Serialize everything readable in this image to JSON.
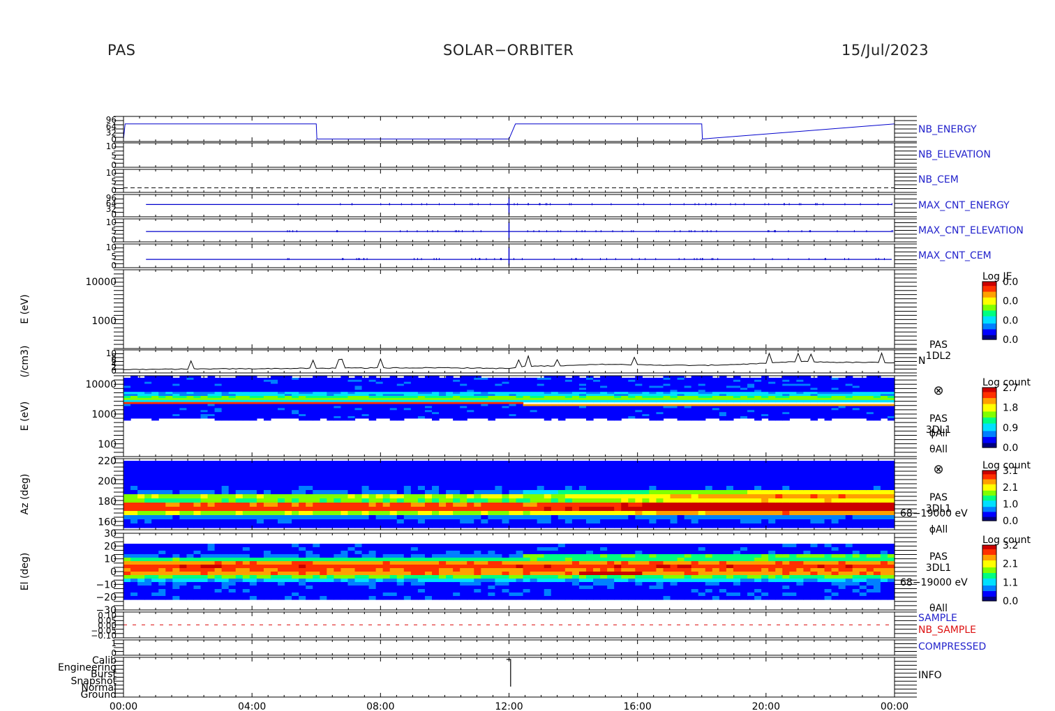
{
  "header": {
    "left": "PAS",
    "center": "SOLAR−ORBITER",
    "right": "15/Jul/2023"
  },
  "colors": {
    "trace_blue": "#0000cc",
    "label_blue": "#2222cc",
    "label_red": "#dd1111",
    "axis": "#000000",
    "spectro_cmap": [
      "#000080",
      "#0000ff",
      "#0080ff",
      "#00e0ff",
      "#00ff80",
      "#80ff00",
      "#ffff00",
      "#ffa000",
      "#ff3000",
      "#cc0000"
    ]
  },
  "x_axis": {
    "ticks": [
      "00:00",
      "04:00",
      "08:00",
      "12:00",
      "16:00",
      "20:00",
      "00:00"
    ]
  },
  "chart_data": [
    {
      "type": "line",
      "panel": "NB_ENERGY",
      "right_label": "NB_ENERGY",
      "label_color": "blue",
      "y_ticks": [
        "96",
        "64",
        "32",
        "0"
      ],
      "x_hours": [
        0,
        0.05,
        6,
        6.02,
        12,
        12.2,
        18,
        18.02,
        24
      ],
      "y_frac": [
        0.9,
        0.3,
        0.3,
        0.9,
        0.9,
        0.3,
        0.3,
        0.9,
        0.3
      ]
    },
    {
      "type": "line",
      "panel": "NB_ELEVATION",
      "right_label": "NB_ELEVATION",
      "label_color": "blue",
      "y_ticks": [
        "10",
        "5",
        "0"
      ]
    },
    {
      "type": "line",
      "panel": "NB_CEM",
      "right_label": "NB_CEM",
      "label_color": "blue",
      "y_ticks": [
        "10",
        "5",
        "0"
      ],
      "dashed_level_frac": 0.2
    },
    {
      "type": "line",
      "panel": "MAX_CNT_ENERGY",
      "right_label": "MAX_CNT_ENERGY",
      "label_color": "blue",
      "y_ticks": [
        "96",
        "64",
        "32",
        "0"
      ],
      "level_frac": 0.55,
      "spike_hour": 12.0
    },
    {
      "type": "line",
      "panel": "MAX_CNT_ELEVATION",
      "right_label": "MAX_CNT_ELEVATION",
      "label_color": "blue",
      "y_ticks": [
        "10",
        "5",
        "0"
      ],
      "level_frac": 0.45,
      "spike_hour": 12.0
    },
    {
      "type": "line",
      "panel": "MAX_CNT_CEM",
      "right_label": "MAX_CNT_CEM",
      "label_color": "blue",
      "y_ticks": [
        "10",
        "5",
        "0"
      ],
      "level_frac": 0.35,
      "spike_hour": 12.0
    },
    {
      "type": "heatmap",
      "panel": "PAS_1DL2_energy",
      "ylabel": "E (eV)",
      "y_ticks": [
        "10000",
        "1000"
      ],
      "colorbar": {
        "title": "Log JE",
        "ticks": [
          "0.0",
          "0.0",
          "0.0",
          "0.0"
        ]
      },
      "empty": true
    },
    {
      "type": "line",
      "panel": "PAS_1DL2_density",
      "ylabel": "(/cm3)",
      "right_label": "N",
      "annotation": [
        "PAS",
        "1DL2"
      ],
      "y_ticks": [
        "10",
        "8",
        "6",
        "4",
        "2",
        "0"
      ],
      "x_hours": [
        0,
        2,
        4,
        6,
        8,
        10,
        12,
        12.5,
        14,
        15,
        16,
        18,
        20,
        21,
        22,
        24
      ],
      "y": [
        1.0,
        1.2,
        1.4,
        1.6,
        1.8,
        1.9,
        1.5,
        2.6,
        3.0,
        3.6,
        3.3,
        3.0,
        4.0,
        5.0,
        4.6,
        4.4
      ]
    },
    {
      "type": "heatmap",
      "panel": "PAS_3DL1_energy",
      "ylabel": "E (eV)",
      "y_ticks": [
        "10000",
        "1000",
        "100"
      ],
      "annotation": [
        "⊗",
        "PAS",
        "3DL1",
        "ϕAll",
        "θAll"
      ],
      "colorbar": {
        "title": "Log count",
        "ticks": [
          "2.7",
          "1.8",
          "0.9",
          "0.0"
        ]
      }
    },
    {
      "type": "heatmap",
      "panel": "PAS_3DL1_azimuth",
      "ylabel": "Az (deg)",
      "y_ticks": [
        "220",
        "200",
        "180",
        "160"
      ],
      "ylim": [
        152,
        222
      ],
      "annotation": [
        "⊗",
        "PAS",
        "3DL1",
        "68−19000 eV",
        "ϕAll"
      ],
      "colorbar": {
        "title": "Log count",
        "ticks": [
          "3.1",
          "2.1",
          "1.0",
          "0.0"
        ]
      }
    },
    {
      "type": "heatmap",
      "panel": "PAS_3DL1_elevation",
      "ylabel": "El (deg)",
      "y_ticks": [
        "30",
        "20",
        "10",
        "0",
        "−10",
        "−20",
        "−30"
      ],
      "ylim": [
        -30,
        30
      ],
      "annotation": [
        "PAS",
        "3DL1",
        "68−19000 eV",
        "θAll"
      ],
      "colorbar": {
        "title": "Log count",
        "ticks": [
          "3.2",
          "2.1",
          "1.1",
          "0.0"
        ]
      }
    },
    {
      "type": "line",
      "panel": "SAMPLE",
      "right_labels": [
        "SAMPLE",
        "NB_SAMPLE"
      ],
      "y_ticks": [
        "0.10",
        "0.05",
        "0.00",
        "−0.05",
        "−0.10"
      ]
    },
    {
      "type": "line",
      "panel": "COMPRESSED",
      "right_label": "COMPRESSED",
      "label_color": "blue",
      "y_ticks": [
        "1",
        "0"
      ]
    },
    {
      "type": "line",
      "panel": "INFO",
      "right_label": "INFO",
      "y_ticks": [
        "Calib",
        "Engineering",
        "Burst",
        "Snapshot",
        "Normal",
        "Ground"
      ]
    }
  ]
}
